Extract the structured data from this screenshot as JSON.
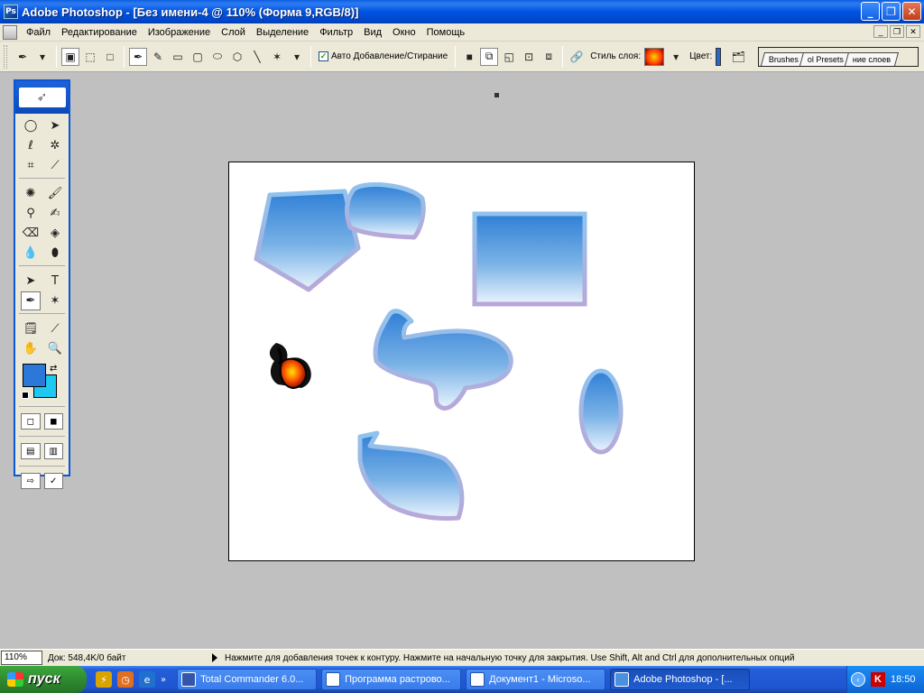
{
  "window": {
    "title": "Adobe Photoshop - [Без имени-4 @ 110% (Форма 9,RGB/8)]",
    "buttons": {
      "minimize": "_",
      "maximize": "❐",
      "close": "✕"
    }
  },
  "menu": {
    "items": [
      "Файл",
      "Редактирование",
      "Изображение",
      "Слой",
      "Выделение",
      "Фильтр",
      "Вид",
      "Окно",
      "Помощь"
    ]
  },
  "options": {
    "auto_add_delete": {
      "label": "Авто Добавление/Стирание",
      "checked": true
    },
    "layer_style_label": "Стиль слоя:",
    "color_label": "Цвет:",
    "palette_tabs": [
      "Brushes",
      "ol Presets",
      "ние слоев"
    ]
  },
  "tools": {
    "foreground_color": "#2b78d8",
    "background_color": "#1ec8f0"
  },
  "status": {
    "zoom": "110%",
    "doc_info": "Док: 548,4K/0 байт",
    "hint": "Нажмите для добавления точек к контуру.  Нажмите на начальную точку для закрытия.  Use Shift, Alt and Ctrl для дополнительных опций"
  },
  "taskbar": {
    "start_label": "пуск",
    "tasks": [
      {
        "label": "Total Commander 6.0...",
        "active": false
      },
      {
        "label": "Программа растрово...",
        "active": false
      },
      {
        "label": "Документ1 - Microso...",
        "active": false
      },
      {
        "label": "Adobe Photoshop - [...",
        "active": true
      }
    ],
    "clock": "18:50"
  }
}
